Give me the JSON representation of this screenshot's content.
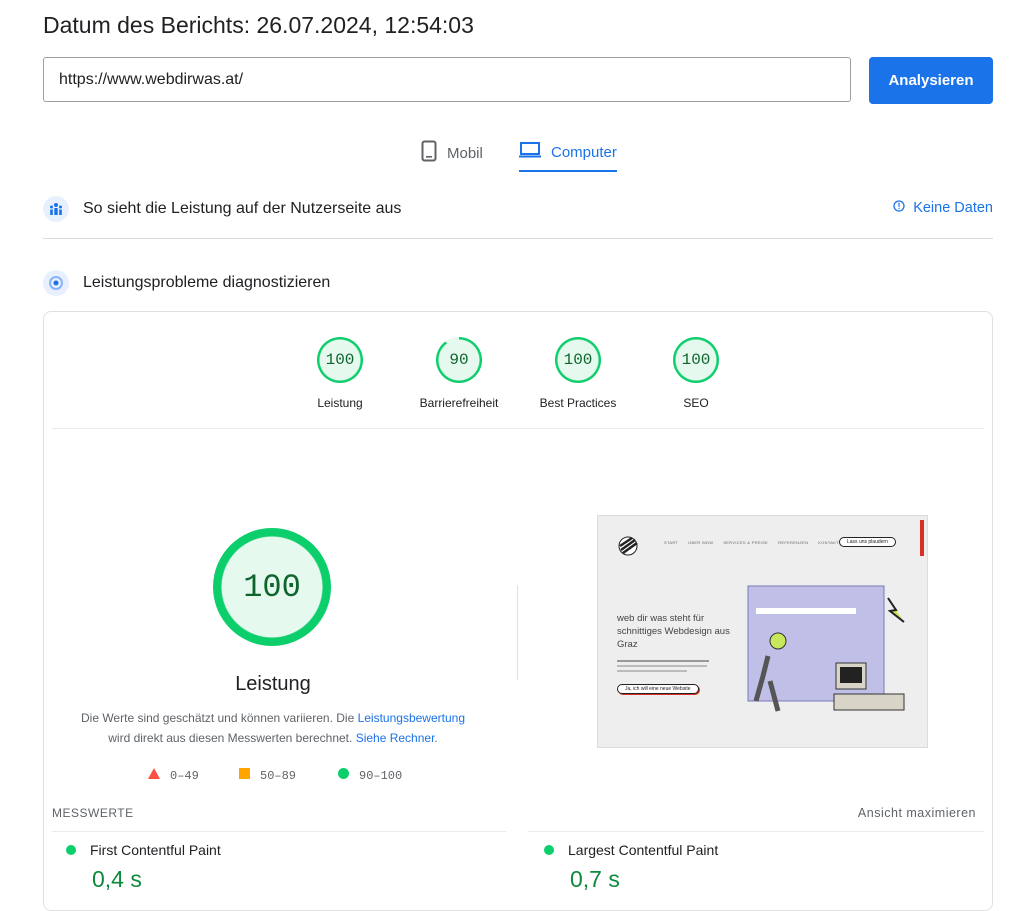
{
  "report": {
    "title": "Datum des Berichts: 26.07.2024, 12:54:03"
  },
  "search": {
    "url_value": "https://www.webdirwas.at/",
    "analyze_label": "Analysieren"
  },
  "tabs": [
    {
      "label": "Mobil",
      "icon": "phone-icon"
    },
    {
      "label": "Computer",
      "icon": "laptop-icon",
      "active": true
    }
  ],
  "field_section": {
    "title": "So sieht die Leistung auf der Nutzerseite aus",
    "no_data": "Keine Daten"
  },
  "lab_section": {
    "title": "Leistungsprobleme diagnostizieren"
  },
  "categories": [
    {
      "score": "100",
      "label": "Leistung",
      "fraction": 1.0
    },
    {
      "score": "90",
      "label": "Barrierefreiheit",
      "fraction": 0.9
    },
    {
      "score": "100",
      "label": "Best Practices",
      "fraction": 1.0
    },
    {
      "score": "100",
      "label": "SEO",
      "fraction": 1.0
    }
  ],
  "performance": {
    "score": "100",
    "title": "Leistung",
    "desc_1": "Die Werte sind geschätzt und können variieren. Die ",
    "desc_link_1": "Leistungsbewertung",
    "desc_2": " wird direkt aus diesen Messwerten berechnet. ",
    "desc_link_2": "Siehe Rechner",
    "desc_3": "."
  },
  "legend": {
    "fail": "0–49",
    "average": "50–89",
    "pass": "90–100"
  },
  "colors": {
    "pass": "#0cce6b",
    "average": "#ffa400",
    "fail": "#ff4e42",
    "accent": "#1a73e8"
  },
  "screenshot": {
    "nav": [
      "START",
      "ÜBER WDW",
      "SERVICES & PREISE",
      "REFERENZEN",
      "KONTAKT"
    ],
    "cta": "Lass uns plaudern",
    "headline_1": "web dir was steht für",
    "headline_2": "schnittiges Webdesign aus",
    "headline_3": "Graz",
    "button": "Ja, ich will eine neue Website"
  },
  "metrics": {
    "label": "MESSWERTE",
    "expand": "Ansicht maximieren",
    "items": [
      {
        "name": "First Contentful Paint",
        "value": "0,4 s"
      },
      {
        "name": "Largest Contentful Paint",
        "value": "0,7 s"
      }
    ]
  }
}
